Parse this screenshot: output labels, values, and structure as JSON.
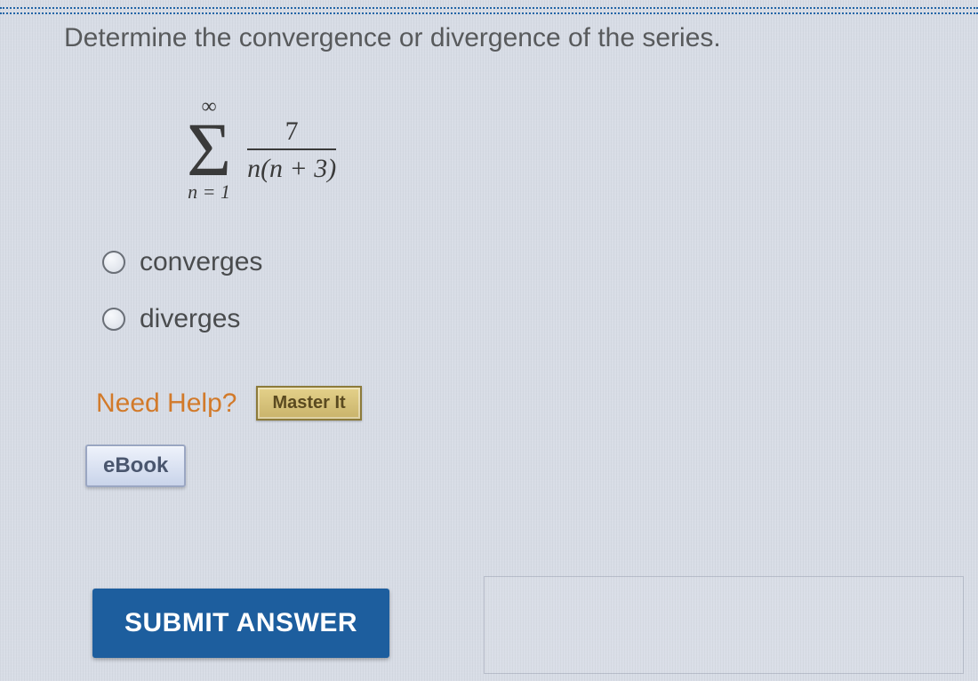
{
  "question": "Determine the convergence or divergence of the series.",
  "formula": {
    "upper": "∞",
    "lower": "n = 1",
    "numerator": "7",
    "denominator": "n(n + 3)"
  },
  "options": {
    "a": "converges",
    "b": "diverges"
  },
  "help": {
    "label": "Need Help?",
    "master": "Master It"
  },
  "ebook": "eBook",
  "submit": "SUBMIT ANSWER"
}
